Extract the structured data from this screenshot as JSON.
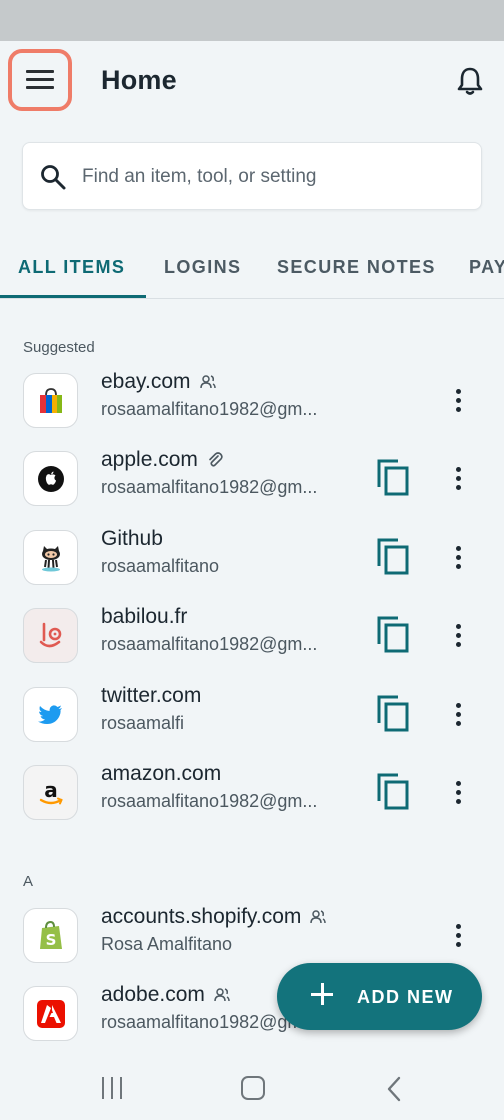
{
  "header": {
    "title": "Home"
  },
  "search": {
    "placeholder": "Find an item, tool, or setting"
  },
  "tabs": [
    {
      "label": "ALL ITEMS",
      "active": true
    },
    {
      "label": "LOGINS",
      "active": false
    },
    {
      "label": "SECURE NOTES",
      "active": false
    },
    {
      "label": "PAY",
      "active": false
    }
  ],
  "sections": {
    "suggested": "Suggested",
    "a": "A"
  },
  "items": [
    {
      "name": "ebay.com",
      "sub": "rosaamalfitano1982@gm...",
      "badge": "shared-icon",
      "copy": false
    },
    {
      "name": "apple.com",
      "sub": "rosaamalfitano1982@gm...",
      "badge": "attachment-icon",
      "copy": true
    },
    {
      "name": "Github",
      "sub": "rosaamalfitano",
      "badge": "",
      "copy": true
    },
    {
      "name": "babilou.fr",
      "sub": "rosaamalfitano1982@gm...",
      "badge": "",
      "copy": true
    },
    {
      "name": "twitter.com",
      "sub": "rosaamalfi",
      "badge": "",
      "copy": true
    },
    {
      "name": "amazon.com",
      "sub": "rosaamalfitano1982@gm...",
      "badge": "",
      "copy": true
    },
    {
      "name": "accounts.shopify.com",
      "sub": "Rosa Amalfitano",
      "badge": "shared-icon",
      "copy": false
    },
    {
      "name": "adobe.com",
      "sub": "rosaamalfitano1982@gm...",
      "badge": "shared-icon",
      "copy": false
    }
  ],
  "fab": {
    "label": "ADD NEW"
  },
  "colors": {
    "accent": "#0e6a74",
    "fab": "#13737c",
    "highlight": "#ef7c68"
  }
}
